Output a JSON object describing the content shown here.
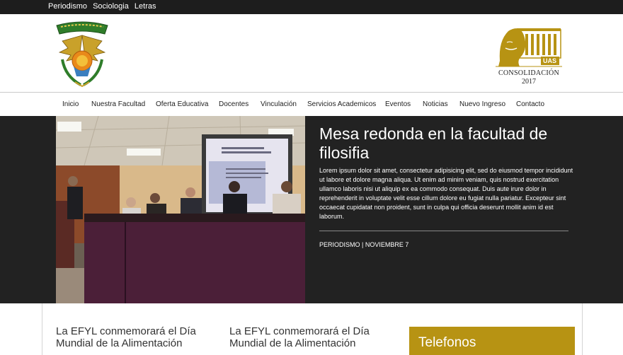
{
  "topbar": {
    "links": [
      "Periodismo",
      "Sociologia",
      "Letras"
    ]
  },
  "header": {
    "left_logo_icon": "coat-of-arms-eagle-emblem",
    "right_logo": {
      "icon": "uas-portrait-building-logo",
      "badge": "UAS",
      "line1": "CONSOLIDACIÓN",
      "line2": "2017"
    },
    "accent_color": "#b79313"
  },
  "nav": {
    "items": [
      "Inicio",
      "Nuestra Facultad",
      "Oferta Educativa",
      "Docentes",
      "Vinculación",
      "Servicios Academicos",
      "Eventos",
      "Noticias",
      "Nuevo Ingreso",
      "Contacto"
    ]
  },
  "hero": {
    "image_icon": "conference-panel-photo",
    "title": "Mesa redonda en la facultad de filosifia",
    "body": "Lorem ipsum dolor sit amet, consectetur adipisicing elit, sed do eiusmod tempor incididunt ut labore et dolore magna aliqua. Ut enim ad minim veniam, quis nostrud exercitation ullamco laboris nisi ut aliquip ex ea commodo consequat. Duis aute irure dolor in reprehenderit in voluptate velit esse cillum dolore eu fugiat nulla pariatur. Excepteur sint occaecat cupidatat non proident, sunt in culpa qui officia deserunt mollit anim id est laborum.",
    "meta": "PERIODISMO | NOVIEMBRE 7"
  },
  "news": [
    {
      "title": "La EFYL conmemorará el Día Mundial de la Alimentación"
    },
    {
      "title": "La EFYL conmemorará el Día Mundial de la Alimentación"
    }
  ],
  "sidebar": {
    "telefonos_title": "Telefonos"
  }
}
